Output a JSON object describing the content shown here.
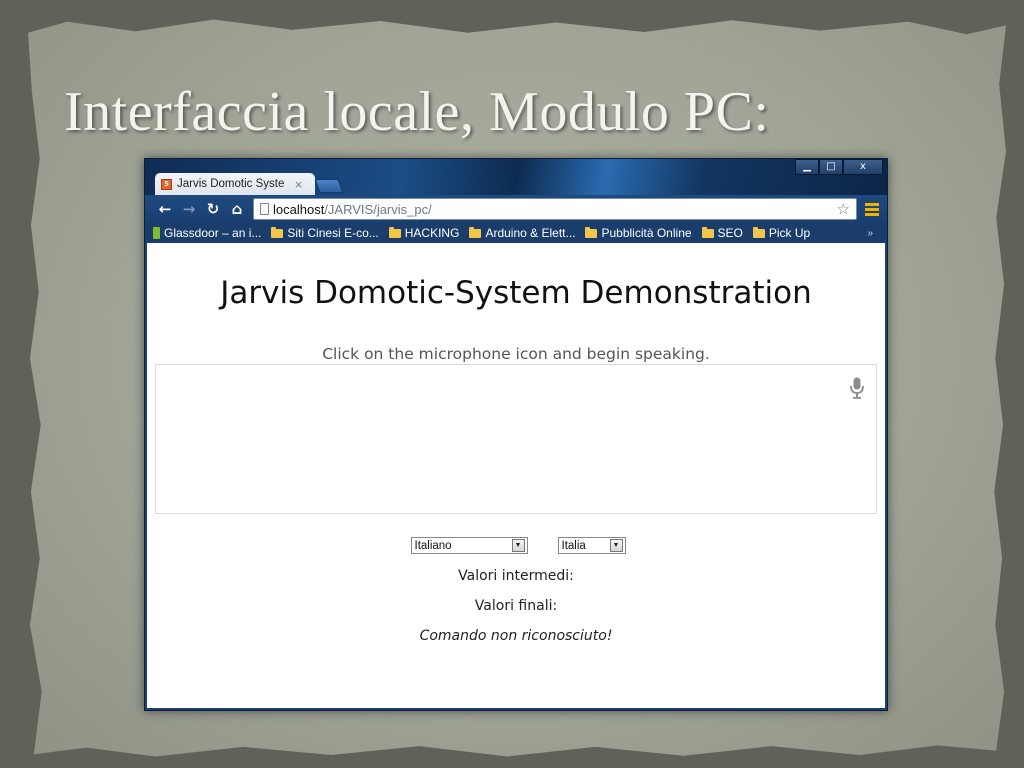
{
  "slide": {
    "title": "Interfaccia locale, Modulo PC:"
  },
  "window_controls": {
    "minimize": "▁",
    "maximize": "□",
    "close": "x"
  },
  "tab": {
    "title": "Jarvis Domotic Syste",
    "close": "×",
    "favicon": "html5-icon"
  },
  "toolbar": {
    "back": "←",
    "forward": "→",
    "reload": "↻",
    "home": "⌂",
    "url_host": "localhost",
    "url_path": "/JARVIS/jarvis_pc/",
    "star": "☆"
  },
  "bookmarks": [
    {
      "label": "Glassdoor – an i...",
      "icon": "glassdoor-icon"
    },
    {
      "label": "Siti Cinesi E-co...",
      "icon": "folder-icon"
    },
    {
      "label": "HACKING",
      "icon": "folder-icon"
    },
    {
      "label": "Arduino & Elett...",
      "icon": "folder-icon"
    },
    {
      "label": "Pubblicità Online",
      "icon": "folder-icon"
    },
    {
      "label": "SEO",
      "icon": "folder-icon"
    },
    {
      "label": "Pick Up",
      "icon": "folder-icon"
    }
  ],
  "bookmarks_more": "»",
  "page": {
    "heading": "Jarvis Domotic-System Demonstration",
    "hint": "Click on the microphone icon and begin speaking.",
    "language_select": "Italiano",
    "dialect_select": "Italia",
    "intermediate_label": "Valori intermedi:",
    "final_label": "Valori finali:",
    "status": "Comando non riconosciuto!"
  },
  "colors": {
    "browser_frame": "#1d3f6f",
    "bookmark_folder": "#f3c64a",
    "menu_icon": "#f0b400"
  }
}
